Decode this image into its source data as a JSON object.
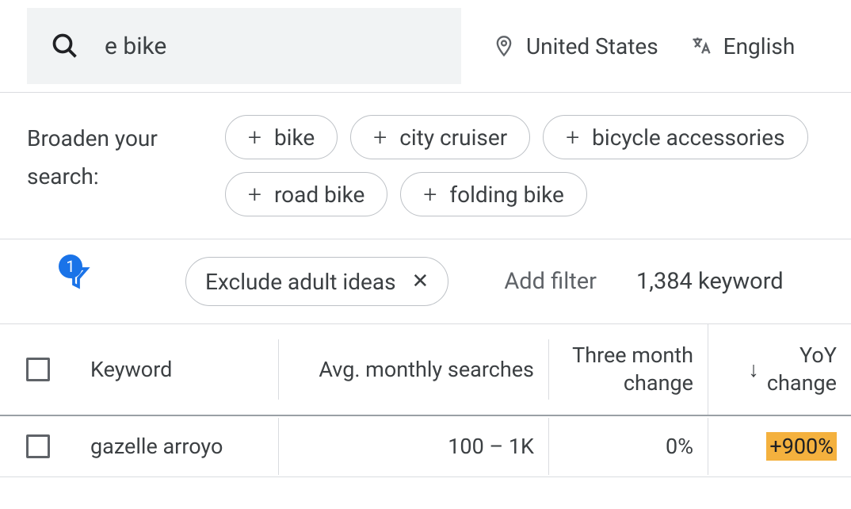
{
  "search": {
    "query": "e bike"
  },
  "location": "United States",
  "language": "English",
  "broaden": {
    "label": "Broaden your search:",
    "chips": [
      "bike",
      "city cruiser",
      "bicycle accessories",
      "road bike",
      "folding bike"
    ]
  },
  "filters": {
    "active_count": "1",
    "exclude_label": "Exclude adult ideas",
    "add_filter": "Add filter",
    "keyword_count": "1,384 keyword"
  },
  "table": {
    "headers": {
      "keyword": "Keyword",
      "searches": "Avg. monthly searches",
      "three_month_1": "Three month",
      "three_month_2": "change",
      "yoy_1": "YoY",
      "yoy_2": "change"
    },
    "rows": [
      {
        "keyword": "gazelle arroyo",
        "searches": "100 – 1K",
        "three_month": "0%",
        "yoy": "+900%"
      }
    ]
  }
}
